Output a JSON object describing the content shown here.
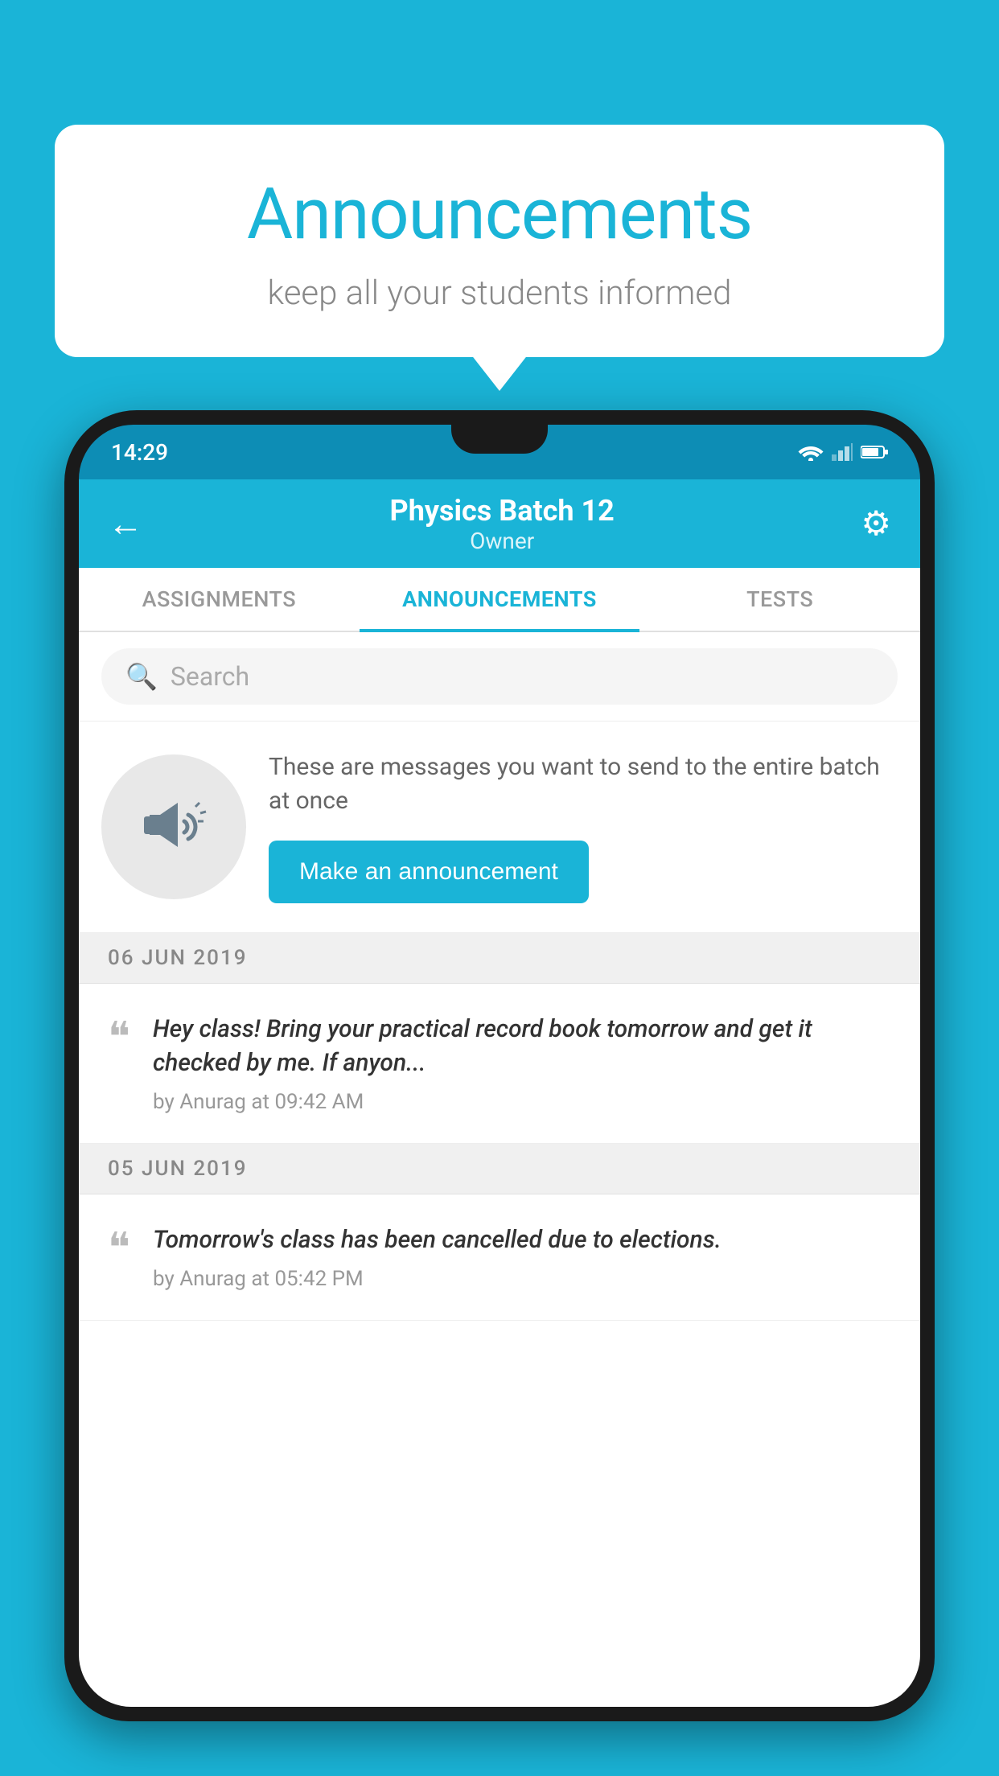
{
  "bubble": {
    "title": "Announcements",
    "subtitle": "keep all your students informed"
  },
  "statusBar": {
    "time": "14:29"
  },
  "header": {
    "title": "Physics Batch 12",
    "subtitle": "Owner"
  },
  "tabs": [
    {
      "label": "ASSIGNMENTS",
      "active": false
    },
    {
      "label": "ANNOUNCEMENTS",
      "active": true
    },
    {
      "label": "TESTS",
      "active": false
    }
  ],
  "search": {
    "placeholder": "Search"
  },
  "promo": {
    "description": "These are messages you want to send to the entire batch at once",
    "button": "Make an announcement"
  },
  "dates": [
    {
      "label": "06  JUN  2019",
      "items": [
        {
          "message": "Hey class! Bring your practical record book tomorrow and get it checked by me. If anyon...",
          "meta": "by Anurag at 09:42 AM"
        }
      ]
    },
    {
      "label": "05  JUN  2019",
      "items": [
        {
          "message": "Tomorrow's class has been cancelled due to elections.",
          "meta": "by Anurag at 05:42 PM"
        }
      ]
    }
  ],
  "icons": {
    "back": "←",
    "gear": "⚙",
    "search": "🔍",
    "quote": "““"
  },
  "colors": {
    "primary": "#1ab4d7",
    "white": "#ffffff",
    "darkBg": "#1a1a1a"
  }
}
